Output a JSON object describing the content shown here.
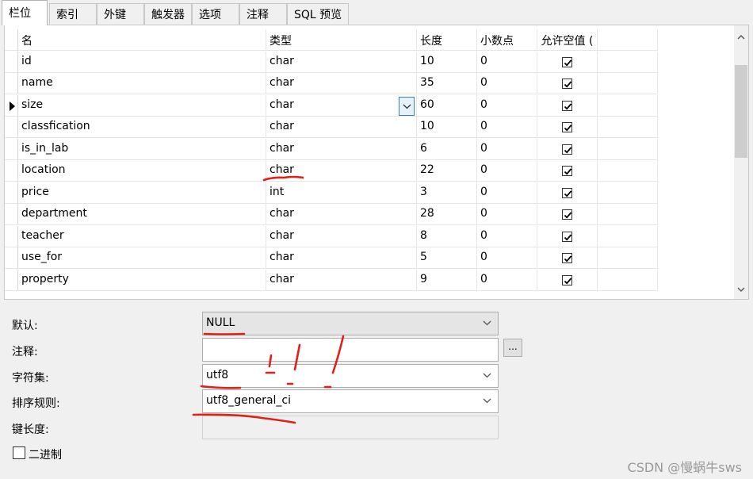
{
  "tabs": [
    "栏位",
    "索引",
    "外键",
    "触发器",
    "选项",
    "注释",
    "SQL 预览"
  ],
  "grid": {
    "headers": {
      "name": "名",
      "type": "类型",
      "length": "长度",
      "decimals": "小数点",
      "allow_null": "允许空值 ("
    },
    "rows": [
      {
        "name": "id",
        "type": "char",
        "length": "10",
        "decimals": "0",
        "allow_null": true
      },
      {
        "name": "name",
        "type": "char",
        "length": "35",
        "decimals": "0",
        "allow_null": true
      },
      {
        "name": "size",
        "type": "char",
        "length": "60",
        "decimals": "0",
        "allow_null": true,
        "selected": true
      },
      {
        "name": "classfication",
        "type": "char",
        "length": "10",
        "decimals": "0",
        "allow_null": true
      },
      {
        "name": "is_in_lab",
        "type": "char",
        "length": "6",
        "decimals": "0",
        "allow_null": true
      },
      {
        "name": "location",
        "type": "char",
        "length": "22",
        "decimals": "0",
        "allow_null": true
      },
      {
        "name": "price",
        "type": "int",
        "length": "3",
        "decimals": "0",
        "allow_null": true
      },
      {
        "name": "department",
        "type": "char",
        "length": "28",
        "decimals": "0",
        "allow_null": true
      },
      {
        "name": "teacher",
        "type": "char",
        "length": "8",
        "decimals": "0",
        "allow_null": true
      },
      {
        "name": "use_for",
        "type": "char",
        "length": "5",
        "decimals": "0",
        "allow_null": true
      },
      {
        "name": "property",
        "type": "char",
        "length": "9",
        "decimals": "0",
        "allow_null": true
      }
    ]
  },
  "properties": {
    "default_label": "默认:",
    "default_value": "NULL",
    "comment_label": "注释:",
    "comment_value": "",
    "ellipsis": "...",
    "charset_label": "字符集:",
    "charset_value": "utf8",
    "collation_label": "排序规则:",
    "collation_value": "utf8_general_ci",
    "key_length_label": "键长度:",
    "key_length_value": "",
    "binary_label": "二进制",
    "binary_checked": false
  },
  "watermark": "CSDN @慢蜗牛sws",
  "colors": {
    "annotation": "#e0201a",
    "accent": "#3c7fb1"
  }
}
